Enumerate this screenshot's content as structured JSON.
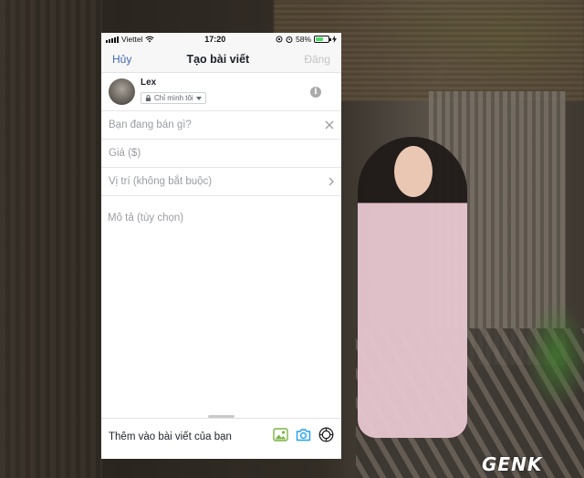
{
  "status_bar": {
    "carrier": "Viettel",
    "time": "17:20",
    "battery": "58%",
    "battery_level": 0.58
  },
  "nav": {
    "cancel": "Hủy",
    "title": "Tạo bài viết",
    "post": "Đăng"
  },
  "user": {
    "name": "Lex",
    "privacy": "Chỉ mình tôi"
  },
  "fields": {
    "item": "Bạn đang bán gì?",
    "price": "Giá ($)",
    "location": "Vị trí (không bắt buộc)",
    "description": "Mô tả (tùy chọn)"
  },
  "bottom": {
    "label": "Thêm vào bài viết của bạn"
  },
  "watermark": "GENK",
  "colors": {
    "accent": "#4267b2",
    "photo_icon": "#7cb342",
    "camera_icon": "#1ea1f2"
  },
  "icons": [
    "photo-icon",
    "camera-icon",
    "tag-icon",
    "info-icon",
    "clear-icon",
    "chevron-right-icon",
    "lock-icon"
  ]
}
